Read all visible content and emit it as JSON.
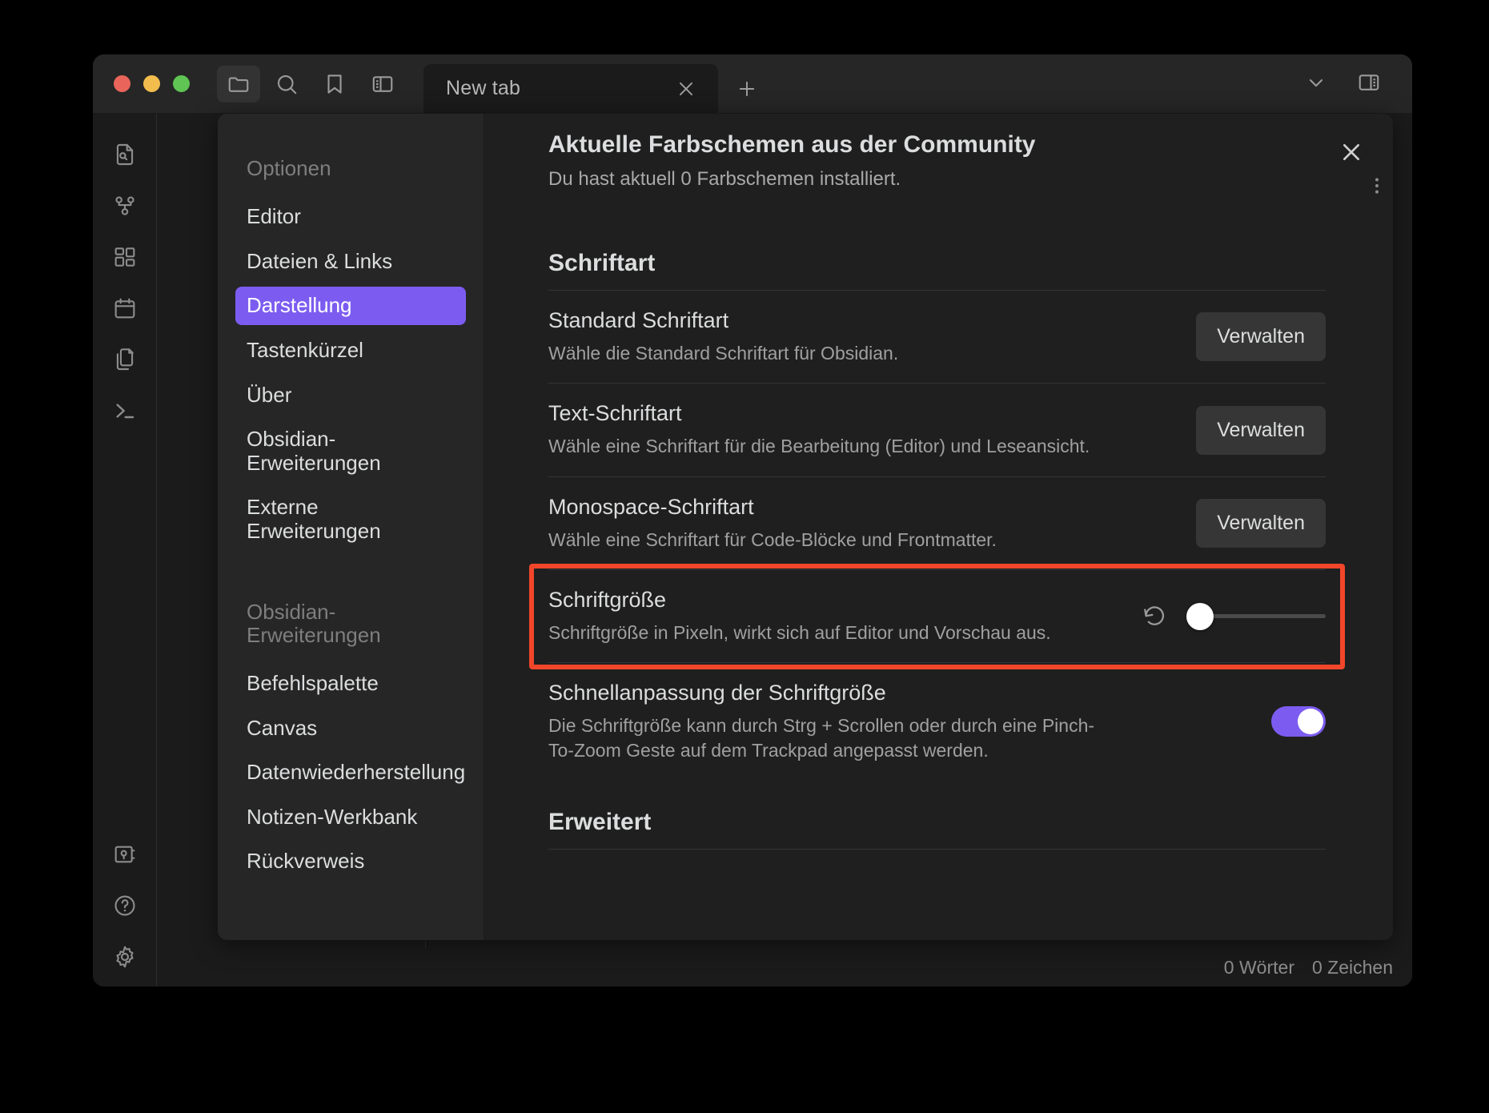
{
  "window": {
    "traffic_lights": [
      "close",
      "minimize",
      "maximize"
    ],
    "toolbar_icons": [
      "folder-icon",
      "search-icon",
      "bookmark-icon",
      "sidebar-left-icon"
    ],
    "right_icons": [
      "chevron-down-icon",
      "sidebar-right-icon"
    ]
  },
  "tabs": {
    "items": [
      {
        "label": "New tab",
        "active": true
      }
    ],
    "close_label": "✕",
    "new_tab_label": "+"
  },
  "left_rail": {
    "icons": [
      "file-search-icon",
      "graph-view-icon",
      "plugins-grid-icon",
      "calendar-icon",
      "copy-files-icon",
      "terminal-icon"
    ],
    "bottom_icons": [
      "vault-icon",
      "help-icon",
      "settings-gear-icon"
    ]
  },
  "settings": {
    "nav": {
      "group1_title": "Optionen",
      "group1_items": [
        {
          "label": "Editor",
          "active": false
        },
        {
          "label": "Dateien & Links",
          "active": false
        },
        {
          "label": "Darstellung",
          "active": true
        },
        {
          "label": "Tastenkürzel",
          "active": false
        },
        {
          "label": "Über",
          "active": false
        },
        {
          "label": "Obsidian-Erweiterungen",
          "active": false
        },
        {
          "label": "Externe Erweiterungen",
          "active": false
        }
      ],
      "group2_title": "Obsidian-Erweiterungen",
      "group2_items": [
        {
          "label": "Befehlspalette",
          "active": false
        },
        {
          "label": "Canvas",
          "active": false
        },
        {
          "label": "Datenwiederherstellung",
          "active": false
        },
        {
          "label": "Notizen-Werkbank",
          "active": false
        },
        {
          "label": "Rückverweis",
          "active": false
        }
      ]
    },
    "close_label": "✕",
    "community_section": {
      "title": "Aktuelle Farbschemen aus der Community",
      "subtitle": "Du hast aktuell 0 Farbschemen installiert."
    },
    "font_heading": "Schriftart",
    "rows": [
      {
        "name": "Standard Schriftart",
        "desc": "Wähle die Standard Schriftart für Obsidian.",
        "control": "button",
        "button_label": "Verwalten"
      },
      {
        "name": "Text-Schriftart",
        "desc": "Wähle eine Schriftart für die Bearbeitung (Editor) und Leseansicht.",
        "control": "button",
        "button_label": "Verwalten"
      },
      {
        "name": "Monospace-Schriftart",
        "desc": "Wähle eine Schriftart für Code-Blöcke und Frontmatter.",
        "control": "button",
        "button_label": "Verwalten"
      },
      {
        "name": "Schriftgröße",
        "desc": "Schriftgröße in Pixeln, wirkt sich auf Editor und Vorschau aus.",
        "control": "slider",
        "slider_value_pct": 0,
        "reset_icon": "reset-arrow-icon"
      },
      {
        "name": "Schnellanpassung der Schriftgröße",
        "desc": "Die Schriftgröße kann durch Strg + Scrollen oder durch eine Pinch-To-Zoom Geste auf dem Trackpad angepasst werden.",
        "control": "toggle",
        "toggle_on": true
      }
    ],
    "advanced_heading": "Erweitert",
    "more_options_icon": "more-vertical-icon"
  },
  "status_bar": {
    "words": "0 Wörter",
    "chars": "0 Zeichen"
  },
  "annotation": {
    "color": "#f2462a",
    "target": "Schriftgröße"
  }
}
